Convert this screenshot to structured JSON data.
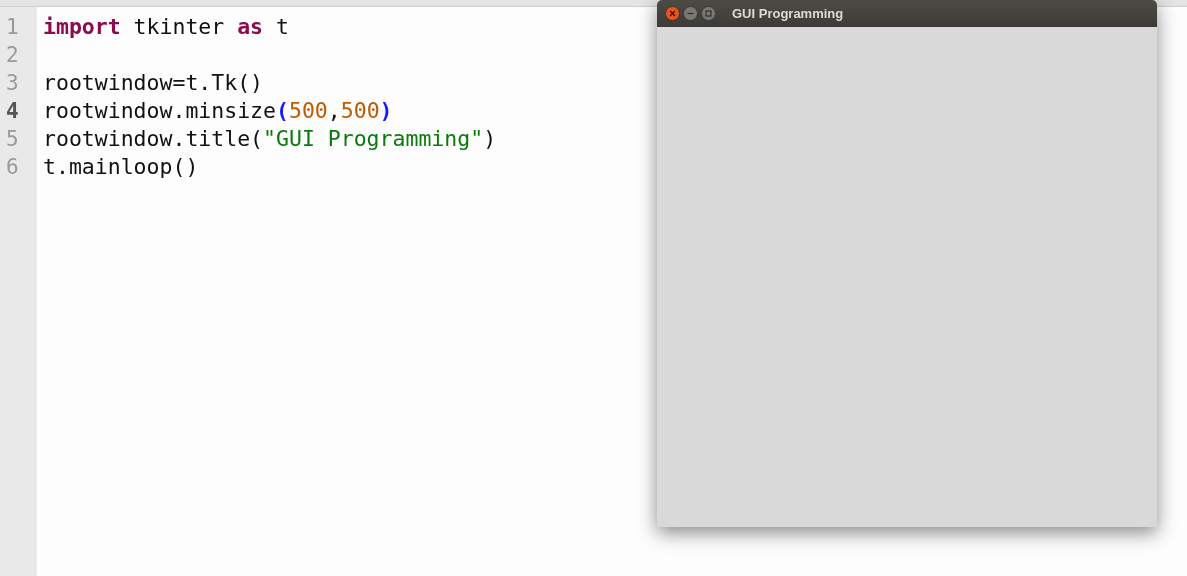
{
  "editor": {
    "lines": [
      {
        "number": "1",
        "current": false,
        "tokens": [
          {
            "text": "import",
            "kind": "keyword"
          },
          {
            "text": " tkinter ",
            "kind": "plain"
          },
          {
            "text": "as",
            "kind": "keyword"
          },
          {
            "text": " t",
            "kind": "plain"
          }
        ]
      },
      {
        "number": "2",
        "current": false
      },
      {
        "number": "3",
        "current": false,
        "tokens": [
          {
            "text": "rootwindow=t.Tk()",
            "kind": "plain"
          }
        ]
      },
      {
        "number": "4",
        "current": true,
        "tokens": [
          {
            "text": "rootwindow.minsize",
            "kind": "plain"
          },
          {
            "text": "(",
            "kind": "bracket"
          },
          {
            "text": "500",
            "kind": "number"
          },
          {
            "text": ",",
            "kind": "plain"
          },
          {
            "text": "500",
            "kind": "number"
          },
          {
            "text": ")",
            "kind": "bracket"
          }
        ]
      },
      {
        "number": "5",
        "current": false,
        "tokens": [
          {
            "text": "rootwindow.title(",
            "kind": "plain"
          },
          {
            "text": "\"GUI Programming\"",
            "kind": "string"
          },
          {
            "text": ")",
            "kind": "plain"
          }
        ]
      },
      {
        "number": "6",
        "current": false,
        "tokens": [
          {
            "text": "t.mainloop()",
            "kind": "plain"
          }
        ]
      }
    ]
  },
  "window": {
    "title": "GUI Programming"
  }
}
